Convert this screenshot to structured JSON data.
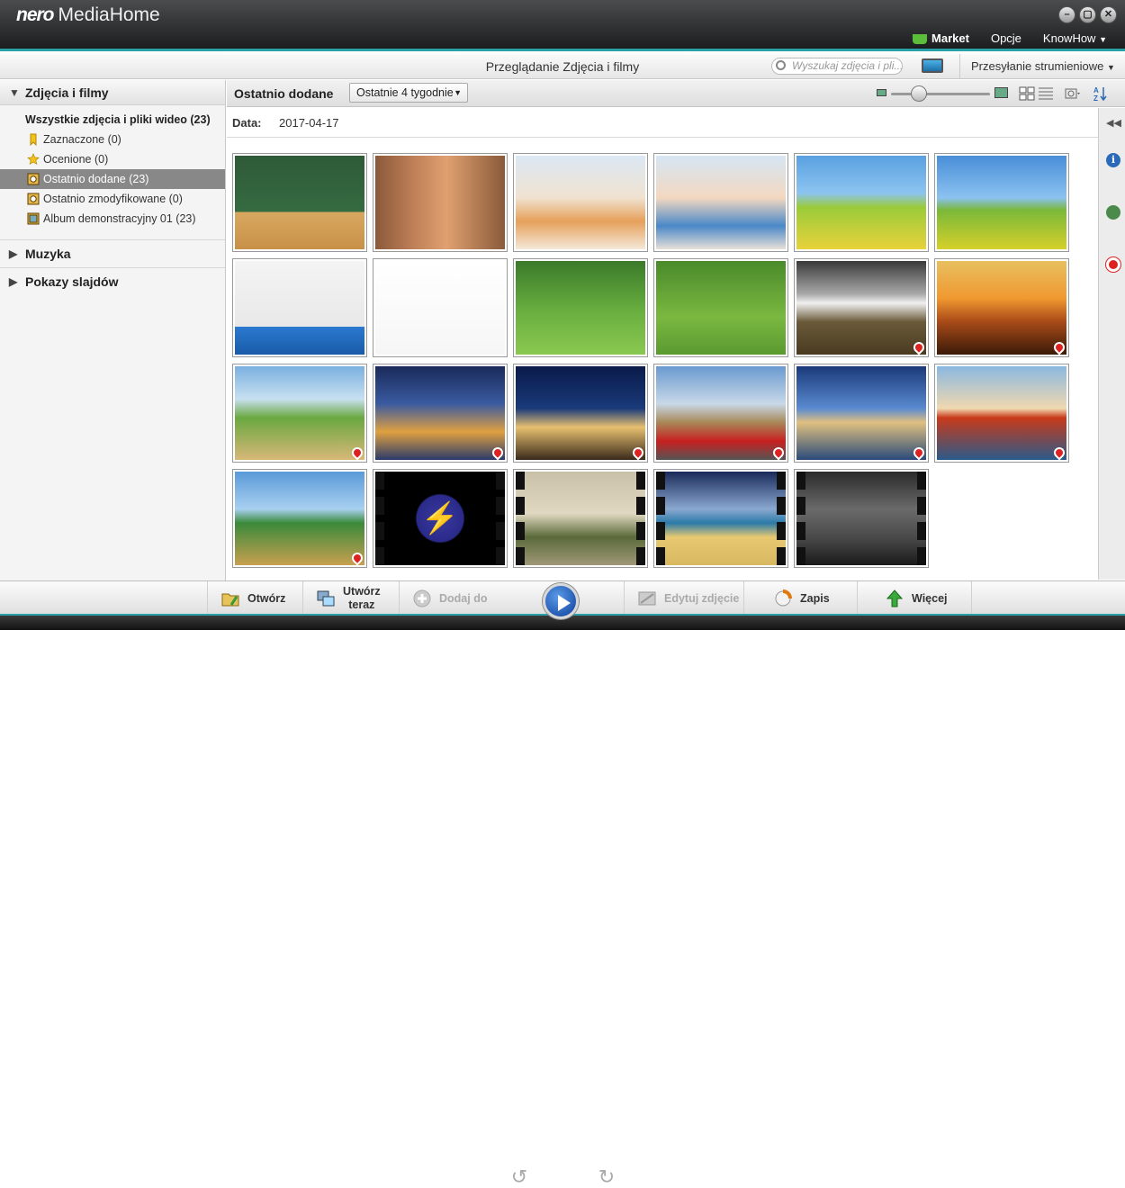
{
  "app": {
    "brand": "nero",
    "name": "MediaHome"
  },
  "window_controls": {
    "minimize": "–",
    "maximize": "▢",
    "close": "✕"
  },
  "topmenu": {
    "market": "Market",
    "options": "Opcje",
    "knowhow": "KnowHow"
  },
  "header": {
    "title": "Przeglądanie Zdjęcia i filmy",
    "search_placeholder": "Wyszukaj zdjęcia i pli...",
    "streaming": "Przesyłanie strumieniowe"
  },
  "sidebar": {
    "section_photos": "Zdjęcia i filmy",
    "all_items": "Wszystkie zdjęcia i pliki wideo (23)",
    "items": [
      {
        "label": "Zaznaczone (0)",
        "icon": "tag-icon",
        "selected": false
      },
      {
        "label": "Ocenione (0)",
        "icon": "star-icon",
        "selected": false
      },
      {
        "label": "Ostatnio dodane (23)",
        "icon": "recent-added-icon",
        "selected": true
      },
      {
        "label": "Ostatnio zmodyfikowane (0)",
        "icon": "recent-modified-icon",
        "selected": false
      },
      {
        "label": "Album demonstracyjny 01 (23)",
        "icon": "album-icon",
        "selected": false
      }
    ],
    "section_music": "Muzyka",
    "section_slideshows": "Pokazy slajdów"
  },
  "toolbar": {
    "view_label": "Ostatnio dodane",
    "range_dropdown": "Ostatnie 4 tygodnie"
  },
  "date_group": {
    "label": "Data:",
    "value": "2017-04-17"
  },
  "thumbnails": [
    {
      "kind": "photo",
      "subject": "school-chalkboard",
      "geotagged": false
    },
    {
      "kind": "photo",
      "subject": "children-group",
      "geotagged": false
    },
    {
      "kind": "photo",
      "subject": "kids-drawing",
      "geotagged": false
    },
    {
      "kind": "photo",
      "subject": "kids-classroom",
      "geotagged": false
    },
    {
      "kind": "photo",
      "subject": "kids-running-meadow",
      "geotagged": false
    },
    {
      "kind": "photo",
      "subject": "kids-running-field",
      "geotagged": false
    },
    {
      "kind": "photo",
      "subject": "karate-kids-blue",
      "geotagged": false
    },
    {
      "kind": "photo",
      "subject": "karate-kids-white",
      "geotagged": false
    },
    {
      "kind": "photo",
      "subject": "kids-playing-soccer",
      "geotagged": false
    },
    {
      "kind": "photo",
      "subject": "kids-with-ball",
      "geotagged": false
    },
    {
      "kind": "photo",
      "subject": "mountain-matterhorn",
      "geotagged": true
    },
    {
      "kind": "photo",
      "subject": "desert-sunset",
      "geotagged": true
    },
    {
      "kind": "photo",
      "subject": "giraffes",
      "geotagged": true
    },
    {
      "kind": "photo",
      "subject": "berlin-night",
      "geotagged": true
    },
    {
      "kind": "photo",
      "subject": "brandenburg-gate",
      "geotagged": true
    },
    {
      "kind": "photo",
      "subject": "london-bus-big-ben",
      "geotagged": true
    },
    {
      "kind": "photo",
      "subject": "london-eye",
      "geotagged": true
    },
    {
      "kind": "photo",
      "subject": "golden-gate-bridge",
      "geotagged": true
    },
    {
      "kind": "photo",
      "subject": "cable-car",
      "geotagged": true
    },
    {
      "kind": "video",
      "subject": "lightning-logo",
      "geotagged": false
    },
    {
      "kind": "video",
      "subject": "3d-room",
      "geotagged": false
    },
    {
      "kind": "video",
      "subject": "beach-render",
      "geotagged": false
    },
    {
      "kind": "video",
      "subject": "city-street-render",
      "geotagged": false
    }
  ],
  "bottombar": {
    "open": "Otwórz",
    "create_now_line1": "Utwórz",
    "create_now_line2": "teraz",
    "add_to": "Dodaj do",
    "edit_photo": "Edytuj zdjęcie",
    "save": "Zapis",
    "more": "Więcej"
  },
  "colors": {
    "accent": "#2aa0a8",
    "selected_row": "#888888",
    "market_green": "#5cbd3c"
  }
}
